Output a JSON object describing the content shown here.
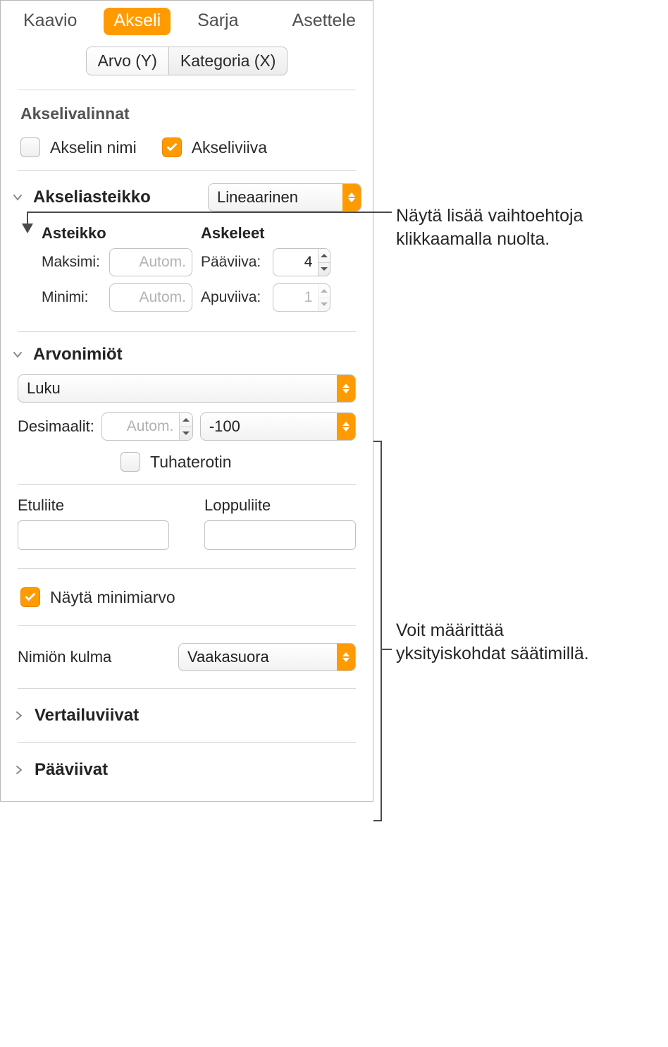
{
  "tabs": {
    "chart": "Kaavio",
    "axis": "Akseli",
    "series": "Sarja",
    "arrange": "Asettele"
  },
  "segmented": {
    "value_y": "Arvo (Y)",
    "category_x": "Kategoria (X)"
  },
  "axis_options": {
    "title": "Akselivalinnat",
    "axis_name": "Akselin nimi",
    "axis_line": "Akseliviiva"
  },
  "axis_scale": {
    "title": "Akseliasteikko",
    "type_value": "Lineaarinen",
    "scale_heading": "Asteikko",
    "steps_heading": "Askeleet",
    "max_label": "Maksimi:",
    "min_label": "Minimi:",
    "auto_placeholder": "Autom.",
    "major_label": "Pääviiva:",
    "minor_label": "Apuviiva:",
    "major_value": "4",
    "minor_value": "1"
  },
  "value_labels": {
    "title": "Arvonimiöt",
    "format_value": "Luku",
    "decimals_label": "Desimaalit:",
    "decimals_placeholder": "Autom.",
    "negative_value": "-100",
    "thousands_label": "Tuhaterotin",
    "prefix_label": "Etuliite",
    "suffix_label": "Loppuliite",
    "show_min_label": "Näytä minimiarvo",
    "angle_label": "Nimiön kulma",
    "angle_value": "Vaakasuora"
  },
  "sections": {
    "reference_lines": "Vertailuviivat",
    "gridlines": "Pääviivat"
  },
  "callouts": {
    "top": "Näytä lisää vaihtoehtoja klikkaamalla nuolta.",
    "mid": "Voit määrittää yksityiskohdat säätimillä."
  }
}
